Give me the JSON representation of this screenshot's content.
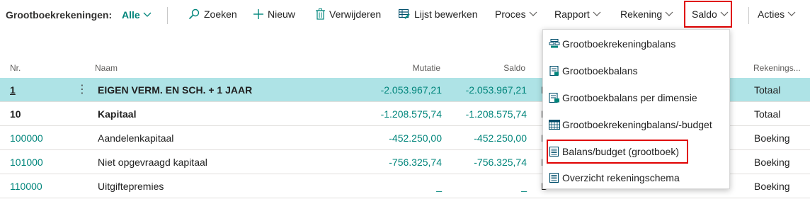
{
  "toolbar": {
    "title": "Grootboekrekeningen:",
    "filter": "Alle",
    "search": "Zoeken",
    "new": "Nieuw",
    "delete": "Verwijderen",
    "edit_list": "Lijst bewerken",
    "process": "Proces",
    "report": "Rapport",
    "account": "Rekening",
    "balance": "Saldo",
    "actions": "Acties"
  },
  "columns": {
    "nr": "Nr.",
    "name": "Naam",
    "mutation": "Mutatie",
    "balance": "Saldo",
    "account_type": "Rekenings..."
  },
  "rows": [
    {
      "nr": "1",
      "name": "EIGEN VERM. EN SCH. + 1 JAAR",
      "mutation": "-2.053.967,21",
      "balance": "-2.053.967,21",
      "col": "B",
      "type": "Totaal"
    },
    {
      "nr": "10",
      "name": "Kapitaal",
      "mutation": "-1.208.575,74",
      "balance": "-1.208.575,74",
      "col": "B",
      "type": "Totaal"
    },
    {
      "nr": "100000",
      "name": "Aandelenkapitaal",
      "mutation": "-452.250,00",
      "balance": "-452.250,00",
      "col": "B",
      "type": "Boeking"
    },
    {
      "nr": "101000",
      "name": "Niet opgevraagd kapitaal",
      "mutation": "-756.325,74",
      "balance": "-756.325,74",
      "col": "B",
      "type": "Boeking"
    },
    {
      "nr": "110000",
      "name": "Uitgiftepremies",
      "mutation": "_",
      "balance": "_",
      "col": "B",
      "type": "Boeking"
    }
  ],
  "dropdown": {
    "items": [
      {
        "label": "Grootboekrekeningbalans",
        "icon": "balance-chart-icon"
      },
      {
        "label": "Grootboekbalans",
        "icon": "document-chart-icon"
      },
      {
        "label": "Grootboekbalans per dimensie",
        "icon": "dimension-chart-icon"
      },
      {
        "label": "Grootboekrekeningbalans/-budget",
        "icon": "budget-grid-icon"
      },
      {
        "label": "Balans/budget (grootboek)",
        "icon": "sheet-icon"
      },
      {
        "label": "Overzicht rekeningschema",
        "icon": "overview-sheet-icon"
      }
    ]
  },
  "colors": {
    "accent": "#00857b",
    "selected_row": "#aee3e6",
    "highlight_box": "#e00000"
  }
}
